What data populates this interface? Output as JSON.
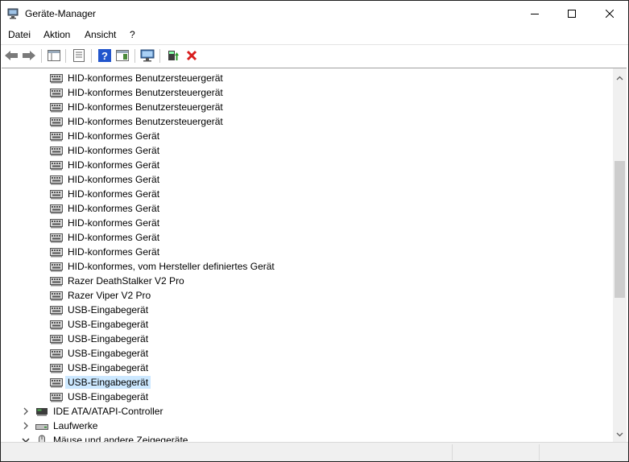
{
  "window": {
    "title": "Geräte-Manager"
  },
  "menu": [
    "Datei",
    "Aktion",
    "Ansicht",
    "?"
  ],
  "toolbar": {
    "buttons": [
      "back-icon",
      "forward-icon",
      "console-tree-icon",
      "properties-icon",
      "help-icon",
      "action-pane-icon",
      "scan-hardware-icon",
      "update-driver-icon",
      "uninstall-icon"
    ]
  },
  "tree": {
    "items": [
      {
        "label": "HID-konformes Benutzersteuergerät",
        "icon": "hid-device-icon",
        "level": 2
      },
      {
        "label": "HID-konformes Benutzersteuergerät",
        "icon": "hid-device-icon",
        "level": 2
      },
      {
        "label": "HID-konformes Benutzersteuergerät",
        "icon": "hid-device-icon",
        "level": 2
      },
      {
        "label": "HID-konformes Benutzersteuergerät",
        "icon": "hid-device-icon",
        "level": 2
      },
      {
        "label": "HID-konformes Gerät",
        "icon": "hid-device-icon",
        "level": 2
      },
      {
        "label": "HID-konformes Gerät",
        "icon": "hid-device-icon",
        "level": 2
      },
      {
        "label": "HID-konformes Gerät",
        "icon": "hid-device-icon",
        "level": 2
      },
      {
        "label": "HID-konformes Gerät",
        "icon": "hid-device-icon",
        "level": 2
      },
      {
        "label": "HID-konformes Gerät",
        "icon": "hid-device-icon",
        "level": 2
      },
      {
        "label": "HID-konformes Gerät",
        "icon": "hid-device-icon",
        "level": 2
      },
      {
        "label": "HID-konformes Gerät",
        "icon": "hid-device-icon",
        "level": 2
      },
      {
        "label": "HID-konformes Gerät",
        "icon": "hid-device-icon",
        "level": 2
      },
      {
        "label": "HID-konformes Gerät",
        "icon": "hid-device-icon",
        "level": 2
      },
      {
        "label": "HID-konformes, vom Hersteller definiertes Gerät",
        "icon": "hid-device-icon",
        "level": 2
      },
      {
        "label": "Razer DeathStalker V2 Pro",
        "icon": "hid-device-icon",
        "level": 2
      },
      {
        "label": "Razer Viper V2 Pro",
        "icon": "hid-device-icon",
        "level": 2
      },
      {
        "label": "USB-Eingabegerät",
        "icon": "hid-device-icon",
        "level": 2
      },
      {
        "label": "USB-Eingabegerät",
        "icon": "hid-device-icon",
        "level": 2
      },
      {
        "label": "USB-Eingabegerät",
        "icon": "hid-device-icon",
        "level": 2
      },
      {
        "label": "USB-Eingabegerät",
        "icon": "hid-device-icon",
        "level": 2
      },
      {
        "label": "USB-Eingabegerät",
        "icon": "hid-device-icon",
        "level": 2
      },
      {
        "label": "USB-Eingabegerät",
        "icon": "hid-device-icon",
        "level": 2,
        "selected": true
      },
      {
        "label": "USB-Eingabegerät",
        "icon": "hid-device-icon",
        "level": 2
      },
      {
        "label": "IDE ATA/ATAPI-Controller",
        "icon": "ide-controller-icon",
        "level": 1,
        "expander": "collapsed"
      },
      {
        "label": "Laufwerke",
        "icon": "disk-drive-icon",
        "level": 1,
        "expander": "collapsed"
      },
      {
        "label": "Mäuse und andere Zeigegeräte",
        "icon": "mouse-icon",
        "level": 1,
        "expander": "expanded"
      }
    ]
  }
}
